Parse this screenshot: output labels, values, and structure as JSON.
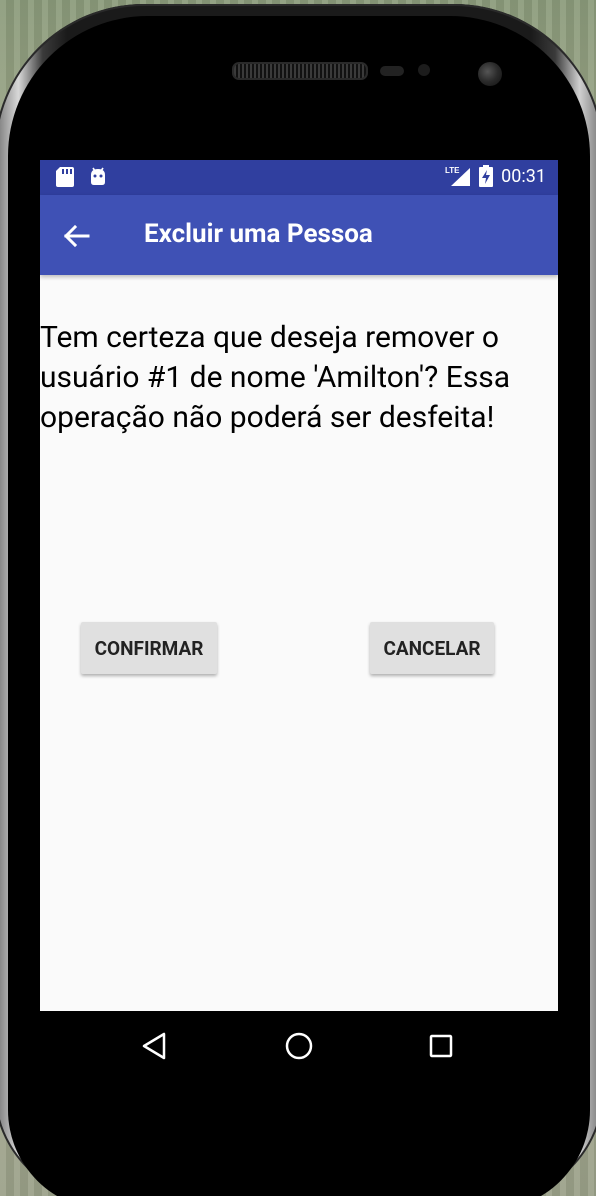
{
  "status_bar": {
    "time": "00:31",
    "network": "LTE",
    "icons": [
      "sd-card-icon",
      "android-icon",
      "signal-icon",
      "battery-charging-icon"
    ]
  },
  "app_bar": {
    "title": "Excluir uma Pessoa",
    "back_icon": "arrow-back-icon"
  },
  "content": {
    "message": "Tem certeza que deseja remover o usuário #1 de nome 'Amilton'? Essa operação não poderá ser desfeita!",
    "confirm_label": "CONFIRMAR",
    "cancel_label": "CANCELAR"
  },
  "nav_bar": {
    "icons": [
      "nav-back-icon",
      "nav-home-icon",
      "nav-recents-icon"
    ]
  },
  "colors": {
    "primary": "#3f51b5",
    "primary_dark": "#303f9f",
    "background": "#fafafa",
    "button": "#e0e0e0"
  }
}
